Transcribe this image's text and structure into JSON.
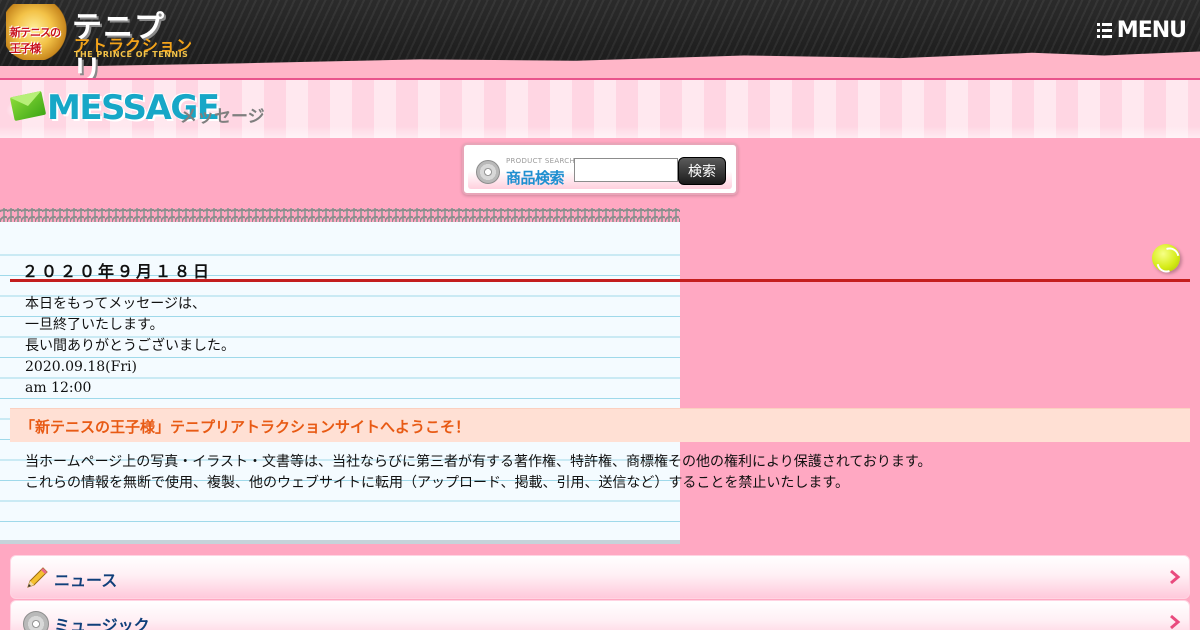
{
  "header": {
    "logo_emblem_text": "新テニスの王子様",
    "logo_title": "テニプリ",
    "logo_subtitle": "アトラクション",
    "logo_english": "THE PRINCE OF TENNIS",
    "menu_label": "MENU"
  },
  "banner": {
    "title": "MESSAGE",
    "subtitle": "メッセージ"
  },
  "search": {
    "caption": "PRODUCT SEARCH",
    "label": "商品検索",
    "input_value": "",
    "button_label": "検索"
  },
  "message": {
    "date": "２０２０年９月１８日",
    "lines": [
      "本日をもってメッセージは、",
      "一旦終了いたします。",
      "長い間ありがとうございました。",
      "2020.09.18(Fri)",
      "am 12:00"
    ]
  },
  "welcome": {
    "text": "「新テニスの王子様」テニプリアトラクションサイトへようこそ！",
    "copyright_lines": [
      "当ホームページ上の写真・イラスト・文書等は、当社ならびに第三者が有する著作権、特許権、商標権その他の権利により保護されております。",
      "これらの情報を無断で使用、複製、他のウェブサイトに転用（アップロード、掲載、引用、送信など）することを禁止いたします。"
    ]
  },
  "nav": {
    "items": [
      {
        "label": "ニュース",
        "icon": "pencil-icon"
      },
      {
        "label": "ミュージック",
        "icon": "disc-icon"
      }
    ]
  },
  "colors": {
    "background": "#ffa8c2",
    "accent_blue": "#17a7c7",
    "rule_red": "#c41e1e",
    "welcome_orange": "#e85a14",
    "nav_text": "#103f7a"
  }
}
